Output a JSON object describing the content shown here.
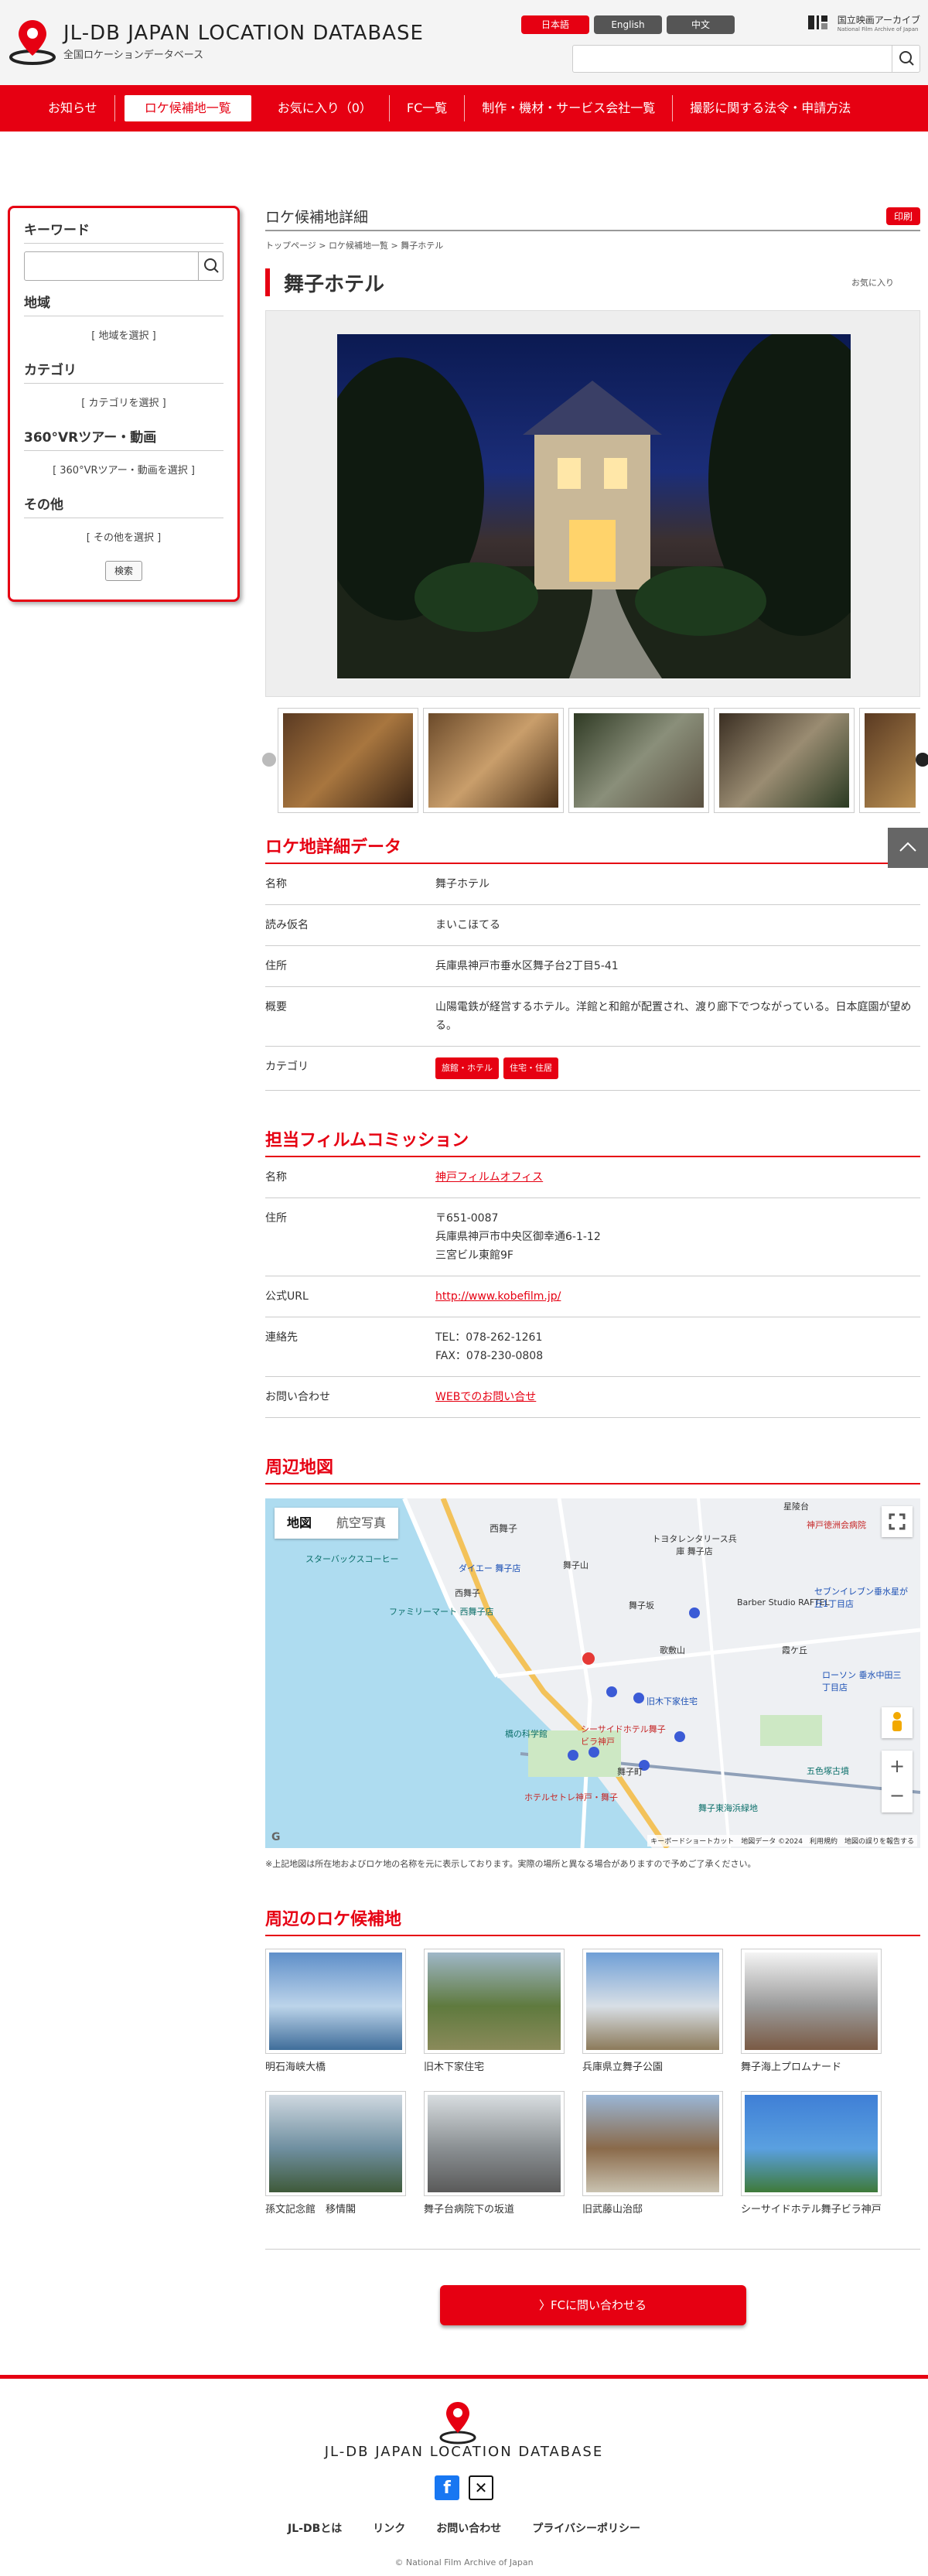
{
  "header": {
    "logo_title": "JL-DB JAPAN LOCATION DATABASE",
    "logo_sub": "全国ロケーションデータベース",
    "langs": [
      "日本語",
      "English",
      "中文"
    ],
    "nfa_name": "国立映画アーカイブ",
    "nfa_sub": "National Film Archive of Japan",
    "search_placeholder": ""
  },
  "nav": [
    "お知らせ",
    "ロケ候補地一覧",
    "お気に入り（0）",
    "FC一覧",
    "制作・機材・サービス会社一覧",
    "撮影に関する法令・申請方法"
  ],
  "sidebar": {
    "keyword": "キーワード",
    "region": "地域",
    "region_val": "[ 地域を選択 ]",
    "category": "カテゴリ",
    "category_val": "[ カテゴリを選択 ]",
    "vr": "360°VRツアー・動画",
    "vr_val": "[ 360°VRツアー・動画を選択 ]",
    "other": "その他",
    "other_val": "[ その他を選択 ]",
    "search_btn": "検索"
  },
  "detail": {
    "section": "ロケ候補地詳細",
    "print": "印刷",
    "breadcrumb": "トップページ > ロケ候補地一覧 > 舞子ホテル",
    "title": "舞子ホテル",
    "fav": "お気に入り"
  },
  "data_section": {
    "heading": "ロケ地詳細データ",
    "rows": [
      {
        "k": "名称",
        "v": "舞子ホテル"
      },
      {
        "k": "読み仮名",
        "v": "まいこほてる"
      },
      {
        "k": "住所",
        "v": "兵庫県神戸市垂水区舞子台2丁目5-41"
      },
      {
        "k": "概要",
        "v": "山陽電鉄が経営するホテル。洋館と和館が配置され、渡り廊下でつながっている。日本庭園が望める。"
      }
    ],
    "category_label": "カテゴリ",
    "tags": [
      "旅館・ホテル",
      "住宅・住居"
    ]
  },
  "fc_section": {
    "heading": "担当フィルムコミッション",
    "name_k": "名称",
    "name_v": "神戸フィルムオフィス",
    "addr_k": "住所",
    "addr_lines": [
      "〒651-0087",
      "兵庫県神戸市中央区御幸通6-1-12",
      "三宮ビル東館9F"
    ],
    "url_k": "公式URL",
    "url_v": "http://www.kobefilm.jp/",
    "contact_k": "連絡先",
    "tel": "TEL：078-262-1261",
    "fax": "FAX：078-230-0808",
    "inquiry_k": "お問い合わせ",
    "inquiry_v": "WEBでのお問い合せ"
  },
  "map_section": {
    "heading": "周辺地図",
    "tab_map": "地図",
    "tab_aerial": "航空写真",
    "note": "※上記地図は所在地およびロケ地の名称を元に表示しております。実際の場所と異なる場合がありますので予めご了承ください。",
    "labels": [
      "星陵台",
      "西舞子",
      "トヨタレンタリース兵庫 舞子店",
      "神戸徳洲会病院",
      "スターバックスコーヒー",
      "ダイエー 舞子店",
      "舞子山",
      "西舞子",
      "ファミリーマート 西舞子店",
      "Barber Studio RAFTEL",
      "歌敷山",
      "舞子坂",
      "霞ケ丘",
      "旧木下家住宅",
      "シーサイドホテル舞子ビラ神戸",
      "橋の科学館",
      "舞子町",
      "ホテルセトレ神戸・舞子",
      "五色塚古墳",
      "舞子東海浜緑地",
      "ローソン 垂水中田三丁目店",
      "セブンイレブン垂水星が丘1丁目店"
    ],
    "attribution": "キーボードショートカット　地図データ ©2024　利用規約　地図の誤りを報告する"
  },
  "near_section": {
    "heading": "周辺のロケ候補地",
    "items": [
      "明石海峡大橋",
      "旧木下家住宅",
      "兵庫県立舞子公園",
      "舞子海上プロムナード",
      "孫文記念館　移情閣",
      "舞子台病院下の坂道",
      "旧武藤山治邸",
      "シーサイドホテル舞子ビラ神戸"
    ]
  },
  "cta": "〉FCに問い合わせる",
  "footer": {
    "logo": "JL-DB JAPAN LOCATION DATABASE",
    "links": [
      "JL-DBとは",
      "リンク",
      "お問い合わせ",
      "プライバシーポリシー"
    ],
    "copyright": "© National Film Archive of Japan"
  },
  "colors": {
    "brand": "#e60012",
    "nav_text": "#ffffff"
  }
}
